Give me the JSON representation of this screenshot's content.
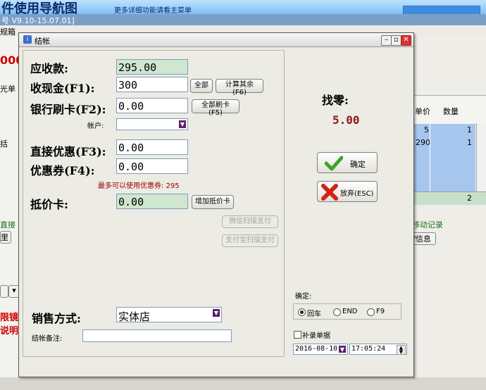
{
  "background": {
    "banner_title": "件使用导航图",
    "banner_subtitle": "更多详细功能请看主菜单",
    "window_title": "号 V9.10-15.07.01]",
    "toolbar_left": "规箱",
    "left_price": "000",
    "left_item": "光单",
    "left_item2": "括",
    "left_direct": "直接",
    "left_button": "里",
    "red_text_1": "限镜",
    "red_text_2": "说明",
    "grid_headers": [
      "单价",
      "数量"
    ],
    "grid_rows": [
      {
        "price": "5",
        "qty": "1"
      },
      {
        "price": "290",
        "qty": "1"
      }
    ],
    "grid_total": "2",
    "move_record": "移动记录",
    "info_button": "f信息"
  },
  "dialog": {
    "title": "结帐",
    "receivable_label": "应收款:",
    "receivable_value": "295.00",
    "cash_label": "收现金(F1):",
    "cash_value": "300",
    "btn_all": "全部",
    "btn_calc_other": "计算其余",
    "btn_calc_other_key": "(F6)",
    "card_label": "银行刷卡(F2):",
    "card_value": "0.00",
    "btn_all_card": "全部刷卡",
    "btn_all_card_key": "(F5)",
    "account_label": "帐户:",
    "direct_discount_label": "直接优惠(F3):",
    "direct_discount_value": "0.00",
    "coupon_label": "优惠券(F4):",
    "coupon_value": "0.00",
    "coupon_hint": "最多可以使用优惠券: 295",
    "voucher_label": "抵价卡:",
    "voucher_value": "0.00",
    "btn_add_voucher": "增加抵价卡",
    "btn_wechat": "微信扫描支付",
    "btn_alipay": "支付宝扫描支付",
    "sales_mode_label": "销售方式:",
    "sales_mode_value": "实体店",
    "remark_label": "结帐备注:",
    "remark_value": "",
    "change_label": "找零:",
    "change_value": "5.00",
    "btn_confirm": "确定",
    "btn_cancel": "放弃(ESC)",
    "confirm_key_label": "确定:",
    "radio_options": [
      "回车",
      "END",
      "F9"
    ],
    "radio_selected": "回车",
    "supplement_label": "补录单据",
    "date_value": "2016-08-10",
    "time_value": "17:05:24"
  }
}
